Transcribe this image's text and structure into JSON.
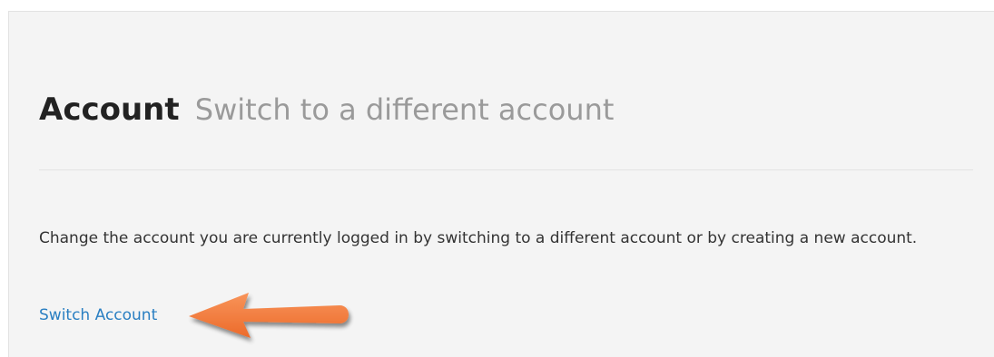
{
  "account_section": {
    "title": "Account",
    "subtitle": "Switch to a different account",
    "description": "Change the account you are currently logged in by switching to a different account or by creating a new account.",
    "switch_link_label": "Switch Account"
  },
  "annotation": {
    "arrow_icon": "arrow-left-icon",
    "arrow_color": "#f47a3a"
  },
  "colors": {
    "panel_background": "#f4f4f4",
    "link": "#2a7fc2",
    "title": "#222222",
    "subtitle": "#9a9a9a"
  }
}
